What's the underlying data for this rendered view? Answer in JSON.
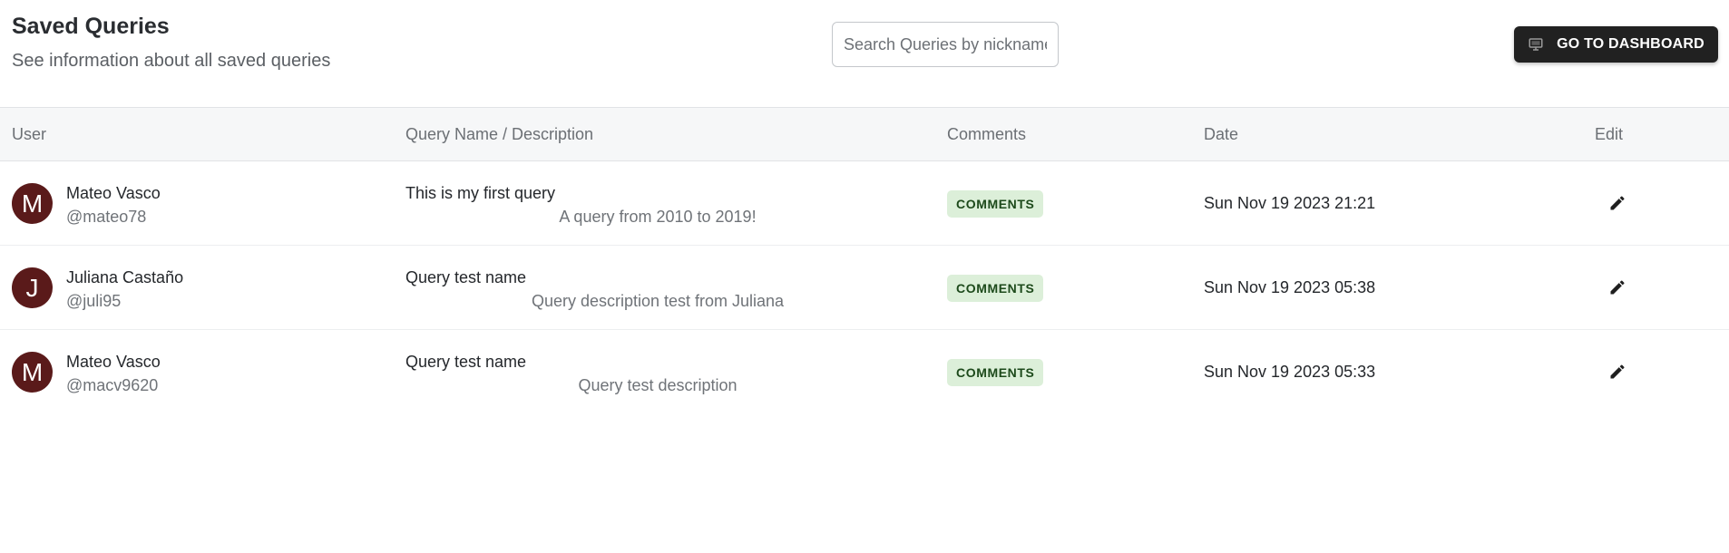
{
  "header": {
    "title": "Saved Queries",
    "subtitle": "See information about all saved queries",
    "search_placeholder": "Search Queries by nickname",
    "dashboard_button_label": "GO TO DASHBOARD",
    "dashboard_button_icon": "monitor-icon"
  },
  "table": {
    "columns": [
      "User",
      "Query Name / Description",
      "Comments",
      "Date",
      "Edit"
    ],
    "rows": [
      {
        "avatar_letter": "M",
        "user_name": "Mateo Vasco",
        "user_handle": "@mateo78",
        "query_name": "This is my first query",
        "query_description": "A query from 2010 to 2019!",
        "comments_label": "COMMENTS",
        "date": "Sun Nov 19 2023 21:21",
        "edit_icon": "pencil-icon"
      },
      {
        "avatar_letter": "J",
        "user_name": "Juliana Castaño",
        "user_handle": "@juli95",
        "query_name": "Query test name",
        "query_description": "Query description test from Juliana",
        "comments_label": "COMMENTS",
        "date": "Sun Nov 19 2023 05:38",
        "edit_icon": "pencil-icon"
      },
      {
        "avatar_letter": "M",
        "user_name": "Mateo Vasco",
        "user_handle": "@macv9620",
        "query_name": "Query test name",
        "query_description": "Query test description",
        "comments_label": "COMMENTS",
        "date": "Sun Nov 19 2023 05:33",
        "edit_icon": "pencil-icon"
      }
    ]
  },
  "colors": {
    "avatar_bg": "#5a1a1a",
    "dashboard_button_bg": "#212121",
    "comments_badge_bg": "#dcefd9",
    "comments_badge_text": "#1d4a1b",
    "table_header_bg": "#f6f7f8"
  }
}
